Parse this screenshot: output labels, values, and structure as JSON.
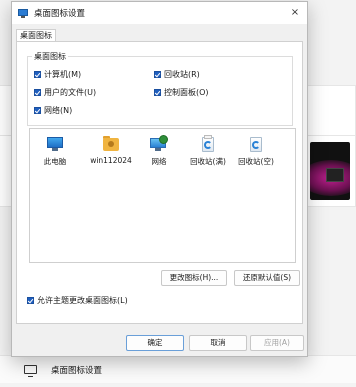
{
  "dialog": {
    "title": "桌面图标设置",
    "close_glyph": "×",
    "tab_label": "桌面图标",
    "group_label": "桌面图标",
    "checkboxes": [
      {
        "label": "计算机(M)",
        "checked": true
      },
      {
        "label": "回收站(R)",
        "checked": true
      },
      {
        "label": "用户的文件(U)",
        "checked": true
      },
      {
        "label": "控制面板(O)",
        "checked": true
      },
      {
        "label": "网络(N)",
        "checked": true
      }
    ],
    "icons": [
      {
        "label": "此电脑",
        "icon": "monitor-icon"
      },
      {
        "label": "win112024",
        "icon": "user-folder-icon"
      },
      {
        "label": "网络",
        "icon": "network-icon"
      },
      {
        "label": "回收站(满)",
        "icon": "recycle-bin-full-icon"
      },
      {
        "label": "回收站(空)",
        "icon": "recycle-bin-empty-icon"
      }
    ],
    "change_icon_label": "更改图标(H)...",
    "restore_default_label": "还原默认值(S)",
    "allow_themes_label": "允许主题更改桌面图标(L)",
    "allow_themes_checked": true,
    "ok_label": "确定",
    "cancel_label": "取消",
    "apply_label": "应用(A)"
  },
  "background": {
    "row_label": "桌面图标设置"
  },
  "colors": {
    "accent": "#1f5fbf"
  }
}
